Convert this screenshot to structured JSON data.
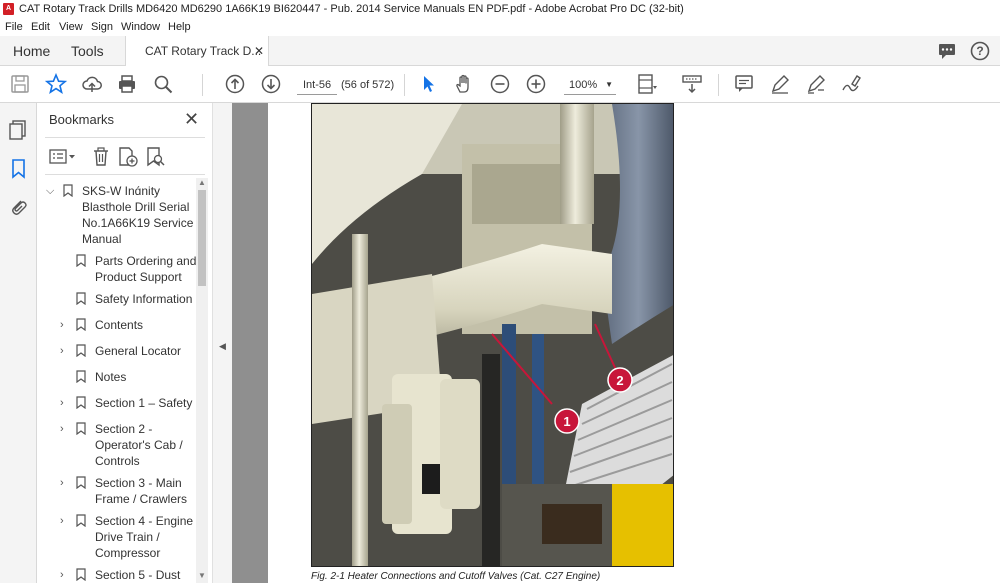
{
  "window": {
    "title": "CAT Rotary Track Drills MD6420 MD6290 1A66K19 BI620447 - Pub. 2014 Service Manuals EN PDF.pdf - Adobe Acrobat Pro DC (32-bit)"
  },
  "menu": [
    "File",
    "Edit",
    "View",
    "Sign",
    "Window",
    "Help"
  ],
  "tabs": {
    "home": "Home",
    "tools": "Tools",
    "document": "CAT Rotary Track D..."
  },
  "toolbar": {
    "page_label": "Int-56",
    "page_count": "(56 of 572)",
    "zoom": "100%"
  },
  "bookmarks": {
    "header": "Bookmarks",
    "items": [
      {
        "label": "SKS-W Inɑ́nity Blasthole Drill Serial No.1A66K19 Service Manual"
      },
      {
        "label": "Parts Ordering and Product Support"
      },
      {
        "label": "Safety Information"
      },
      {
        "label": "Contents"
      },
      {
        "label": "General Locator"
      },
      {
        "label": "Notes"
      },
      {
        "label": "Section 1 – Safety"
      },
      {
        "label": "Section 2 - Operator's Cab / Controls"
      },
      {
        "label": "Section 3 - Main Frame / Crawlers"
      },
      {
        "label": "Section 4 - Engine / Drive Train / Compressor"
      },
      {
        "label": "Section 5 - Dust"
      }
    ]
  },
  "document": {
    "callouts": [
      "1",
      "2"
    ],
    "caption": "Fig. 2-1 Heater Connections and Cutoff Valves (Cat. C27 Engine)"
  },
  "colors": {
    "callout": "#c8163a",
    "accent": "#1473e6",
    "pdf_red": "#d21f26"
  }
}
